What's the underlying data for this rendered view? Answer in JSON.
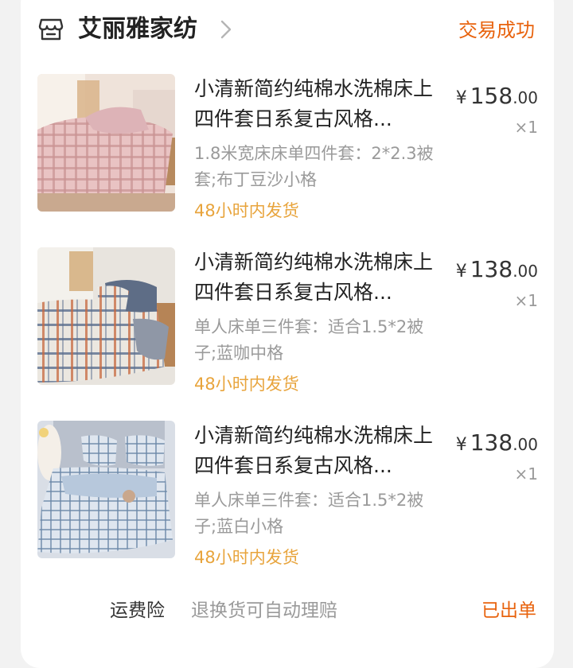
{
  "shop": {
    "name": "艾丽雅家纺",
    "icon": "store-icon",
    "chevron_icon": "chevron-right-icon",
    "order_status": "交易成功"
  },
  "items": [
    {
      "image": "bedding-pink-plaid",
      "title": "小清新简约纯棉水洗棉床上四件套日系复古风格...",
      "spec": "1.8米宽床床单四件套：2*2.3被套;布丁豆沙小格",
      "shipping": "48小时内发货",
      "currency": "¥",
      "price_int": "158",
      "price_dec": ".00",
      "quantity": "×1"
    },
    {
      "image": "bedding-blue-coffee-plaid",
      "title": "小清新简约纯棉水洗棉床上四件套日系复古风格...",
      "spec": "单人床单三件套：适合1.5*2被子;蓝咖中格",
      "shipping": "48小时内发货",
      "currency": "¥",
      "price_int": "138",
      "price_dec": ".00",
      "quantity": "×1"
    },
    {
      "image": "bedding-blue-white-plaid",
      "title": "小清新简约纯棉水洗棉床上四件套日系复古风格...",
      "spec": "单人床单三件套：适合1.5*2被子;蓝白小格",
      "shipping": "48小时内发货",
      "currency": "¥",
      "price_int": "138",
      "price_dec": ".00",
      "quantity": "×1"
    }
  ],
  "insurance": {
    "label": "运费险",
    "description": "退换货可自动理赔",
    "status": "已出单"
  },
  "colors": {
    "accent_orange": "#e8630e",
    "shipping_gold": "#e8a43c",
    "secondary_text": "#9a9a9a"
  }
}
